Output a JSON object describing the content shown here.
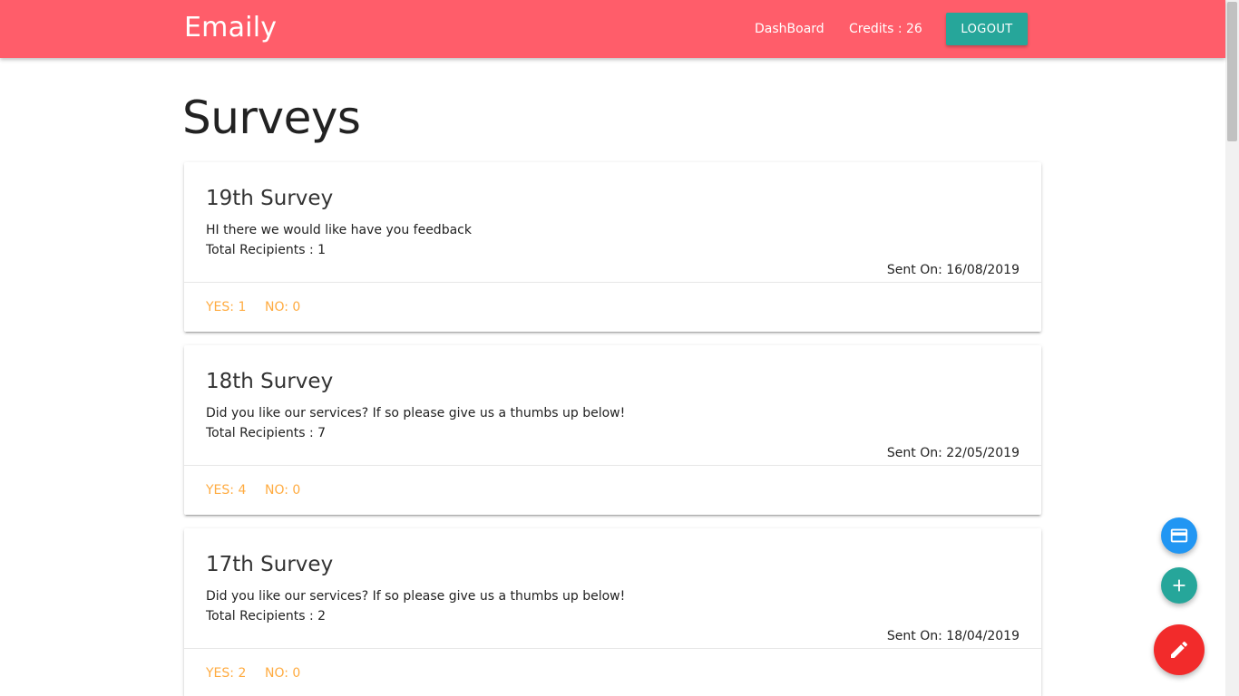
{
  "navbar": {
    "brand": "Emaily",
    "dashboard_label": "DashBoard",
    "credits_label": "Credits : 26",
    "logout_label": "LOGOUT",
    "color": "#ff5d6a"
  },
  "main": {
    "title": "Surveys"
  },
  "surveys": [
    {
      "title": "19th Survey",
      "body": "HI there we would like have you feedback",
      "recipients": "Total Recipients : 1",
      "sent_on": "Sent On: 16/08/2019",
      "yes": "YES: 1",
      "no": "NO: 0"
    },
    {
      "title": "18th Survey",
      "body": "Did you like our services? If so please give us a thumbs up below!",
      "recipients": "Total Recipients : 7",
      "sent_on": "Sent On: 22/05/2019",
      "yes": "YES: 4",
      "no": "NO: 0"
    },
    {
      "title": "17th Survey",
      "body": "Did you like our services? If so please give us a thumbs up below!",
      "recipients": "Total Recipients : 2",
      "sent_on": "Sent On: 18/04/2019",
      "yes": "YES: 2",
      "no": "NO: 0"
    }
  ],
  "fabs": [
    {
      "icon": "credit-card-icon",
      "color": "#2196f3"
    },
    {
      "icon": "plus-icon",
      "color": "#26a69a"
    },
    {
      "icon": "pencil-icon",
      "color": "#f22b2b"
    }
  ],
  "colors": {
    "accent": "#26a69a",
    "vote": "#ffab40"
  }
}
